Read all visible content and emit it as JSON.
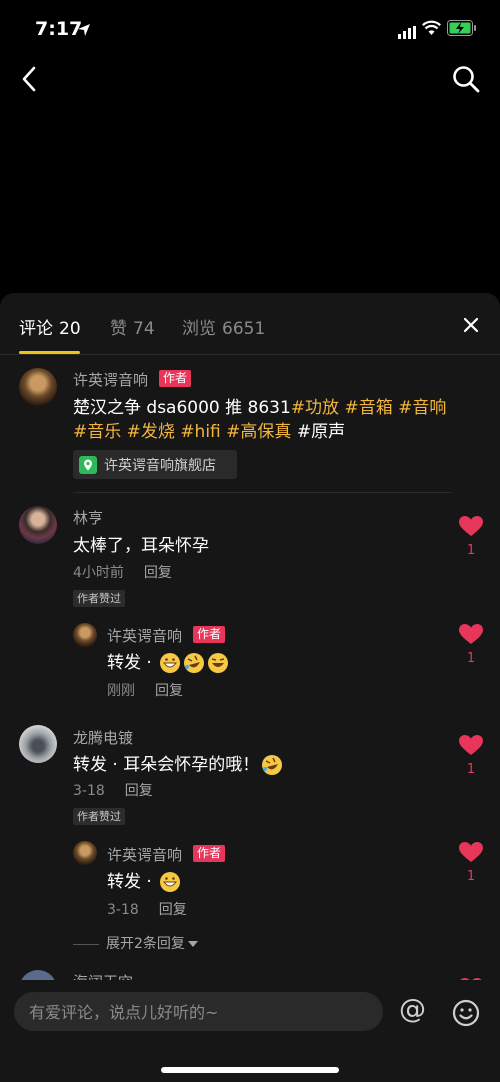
{
  "status": {
    "time": "7:17"
  },
  "tabs": [
    {
      "label": "评论",
      "count": "20"
    },
    {
      "label": "赞",
      "count": "74"
    },
    {
      "label": "浏览",
      "count": "6651"
    }
  ],
  "post": {
    "author": "许英谔音响",
    "badge": "作者",
    "line1": [
      "楚汉之争 dsa6000 推 8631",
      "#功放",
      " ",
      "#音箱",
      " ",
      "#音响"
    ],
    "line2": [
      "#音乐",
      " ",
      "#发烧",
      " ",
      "#hifi",
      " ",
      "#高保真",
      " ",
      "#原声"
    ],
    "shop": "许英谔音响旗舰店"
  },
  "comments": [
    {
      "name": "林亨",
      "text": "太棒了，耳朵怀孕",
      "time": "4小时前",
      "reply_label": "回复",
      "likes": "1",
      "approved": "作者赞过",
      "reply": {
        "name": "许英谔音响",
        "badge": "作者",
        "text": "转发 · ",
        "time": "刚刚",
        "reply_label": "回复",
        "likes": "1"
      }
    },
    {
      "name": "龙腾电镀",
      "text": "转发 · 耳朵会怀孕的哦！",
      "time": "3-18",
      "reply_label": "回复",
      "likes": "1",
      "approved": "作者赞过",
      "reply": {
        "name": "许英谔音响",
        "badge": "作者",
        "text": "转发 · ",
        "time": "3-18",
        "reply_label": "回复",
        "likes": "1"
      },
      "expand": "展开2条回复"
    },
    {
      "name": "海阔天空"
    }
  ],
  "input": {
    "placeholder": "有爱评论，说点儿好听的~"
  },
  "colors": {
    "accent": "#f3b53c",
    "like": "#e8365a",
    "underline": "#f2c21b"
  }
}
